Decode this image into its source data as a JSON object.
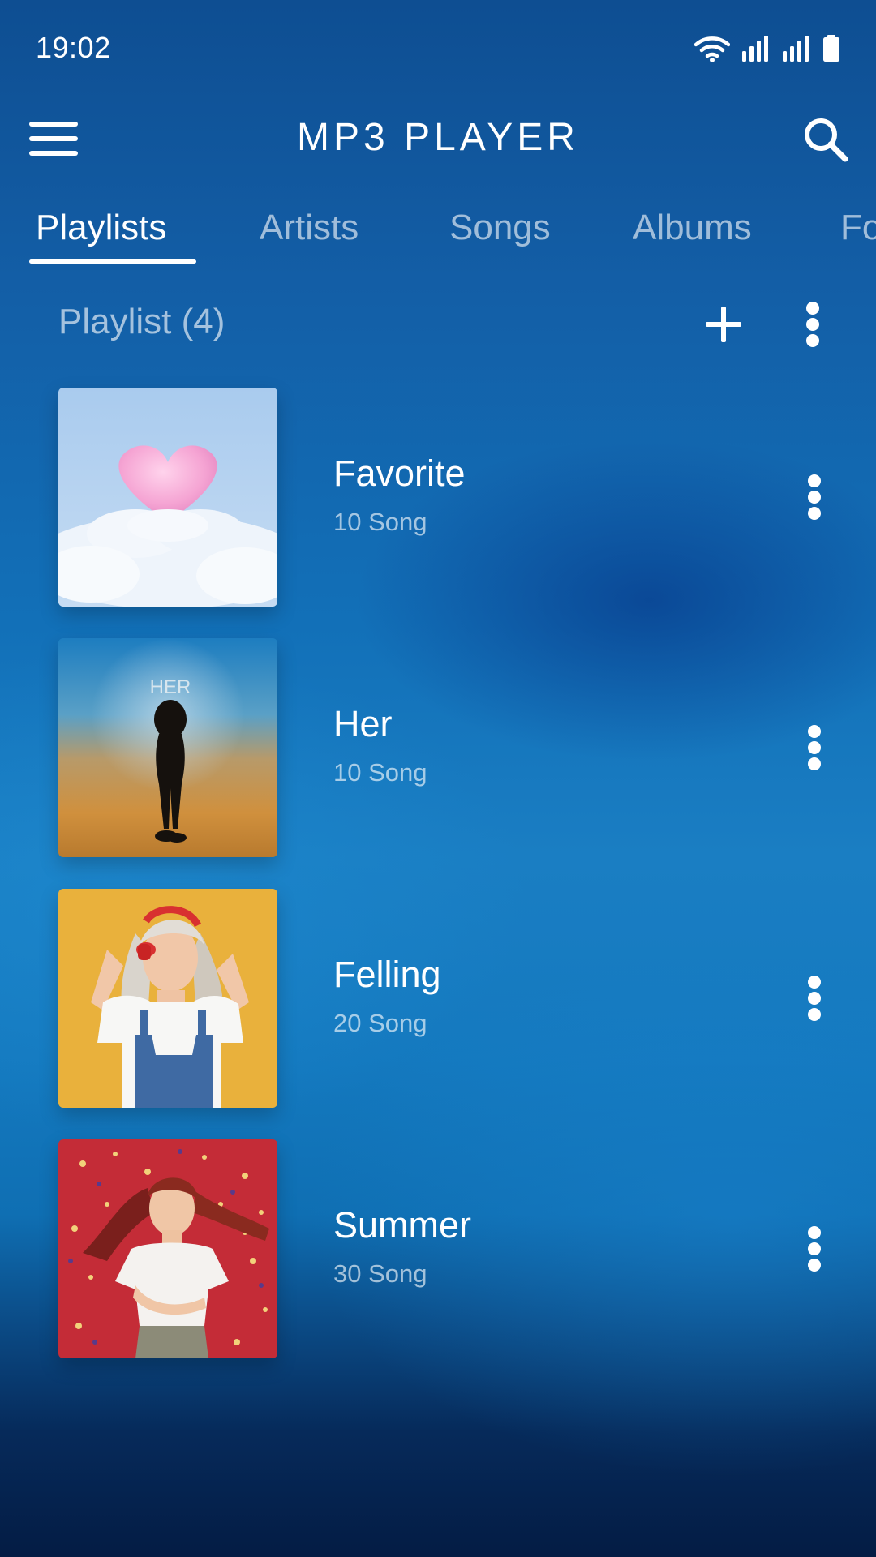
{
  "status_bar": {
    "time": "19:02",
    "icons": [
      "wifi-icon",
      "signal-icon",
      "signal-icon",
      "battery-icon"
    ]
  },
  "app_bar": {
    "title": "MP3 PLAYER",
    "menu_icon": "menu-icon",
    "search_icon": "search-icon"
  },
  "tabs": [
    {
      "label": "Playlists",
      "active": true
    },
    {
      "label": "Artists",
      "active": false
    },
    {
      "label": "Songs",
      "active": false
    },
    {
      "label": "Albums",
      "active": false
    },
    {
      "label": "Fo",
      "active": false
    }
  ],
  "section": {
    "title": "Playlist (4)",
    "add_icon": "plus-icon",
    "more_icon": "more-vertical-icon"
  },
  "playlists": [
    {
      "name": "Favorite",
      "count": "10 Song",
      "cover": "heart-on-cloud-artwork"
    },
    {
      "name": "Her",
      "count": "10 Song",
      "cover": "her-album-artwork",
      "cover_text": "HER"
    },
    {
      "name": "Felling",
      "count": "20 Song",
      "cover": "woman-with-headphones-photo"
    },
    {
      "name": "Summer",
      "count": "30 Song",
      "cover": "woman-on-red-background-photo"
    }
  ],
  "colors": {
    "background_top": "#0e4e92",
    "background_mid": "#1a7ec3",
    "background_bottom": "#041c44",
    "text_primary": "#ffffff",
    "text_secondary": "rgba(255,255,255,0.62)"
  }
}
